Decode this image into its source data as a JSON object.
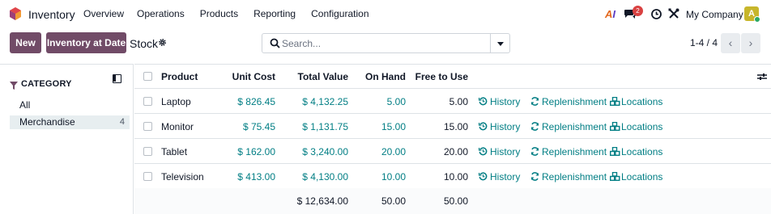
{
  "app": {
    "name": "Inventory"
  },
  "menu": [
    "Overview",
    "Operations",
    "Products",
    "Reporting",
    "Configuration"
  ],
  "systray": {
    "ai_label_1": "A",
    "ai_label_2": "I",
    "chat_count": "2",
    "company": "My Company",
    "avatar_letter": "A"
  },
  "control": {
    "new_label": "New",
    "date_label": "Inventory at Date",
    "title": "Stock",
    "search_placeholder": "Search...",
    "pager": "1-4 / 4"
  },
  "sidebar": {
    "title": "CATEGORY",
    "items": [
      {
        "label": "All",
        "count": ""
      },
      {
        "label": "Merchandise",
        "count": "4"
      }
    ]
  },
  "table": {
    "columns": [
      "Product",
      "Unit Cost",
      "Total Value",
      "On Hand",
      "Free to Use"
    ],
    "actions": [
      "History",
      "Replenishment",
      "Locations"
    ],
    "rows": [
      {
        "product": "Laptop",
        "unit_cost": "$ 826.45",
        "total_value": "$ 4,132.25",
        "on_hand": "5.00",
        "free": "5.00"
      },
      {
        "product": "Monitor",
        "unit_cost": "$ 75.45",
        "total_value": "$ 1,131.75",
        "on_hand": "15.00",
        "free": "15.00"
      },
      {
        "product": "Tablet",
        "unit_cost": "$ 162.00",
        "total_value": "$ 3,240.00",
        "on_hand": "20.00",
        "free": "20.00"
      },
      {
        "product": "Television",
        "unit_cost": "$ 413.00",
        "total_value": "$ 4,130.00",
        "on_hand": "10.00",
        "free": "10.00"
      }
    ],
    "totals": {
      "total_value": "$ 12,634.00",
      "on_hand": "50.00",
      "free": "50.00"
    }
  },
  "colors": {
    "brand": "#714b67",
    "link": "#017e84",
    "badge": "#d94141"
  },
  "icons": [
    "app-logo-icon",
    "ai-icon",
    "chat-icon",
    "clock-icon",
    "tools-icon",
    "gear-icon",
    "search-icon",
    "filter-icon",
    "panel-toggle-icon",
    "history-icon",
    "replenish-icon",
    "locations-icon",
    "adjust-columns-icon"
  ]
}
